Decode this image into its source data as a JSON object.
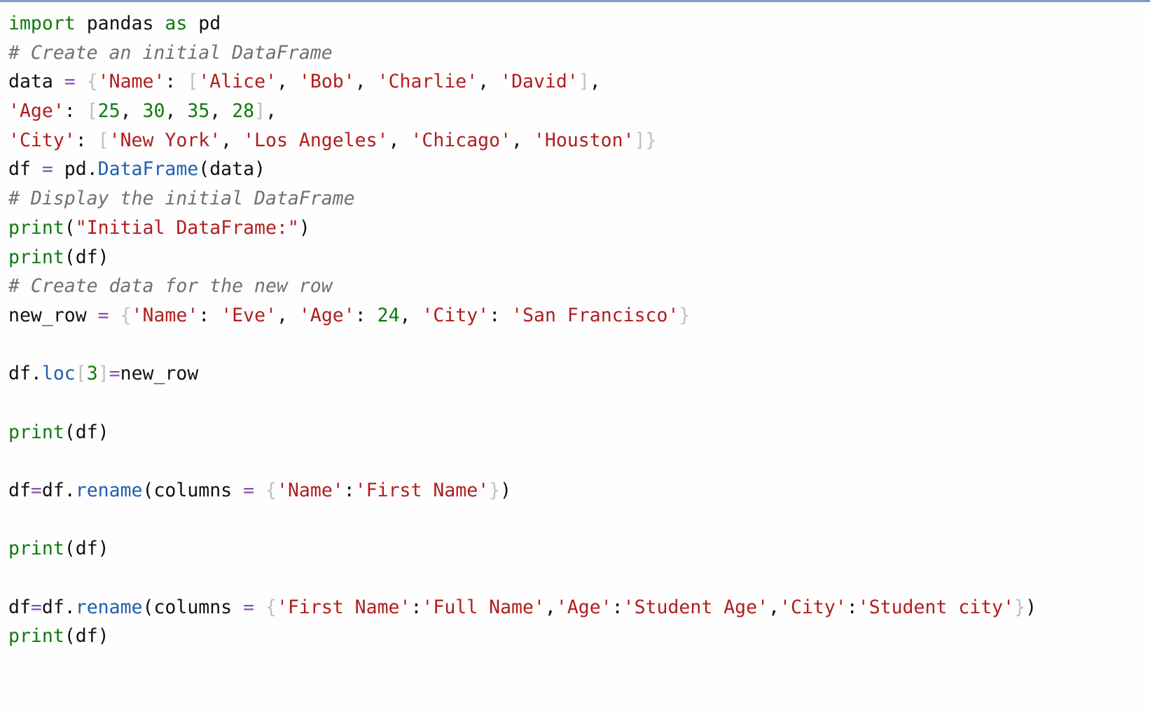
{
  "editor": {
    "language": "python",
    "lines": [
      {
        "tokens": [
          {
            "t": "import",
            "c": "kw"
          },
          {
            "t": " pandas ",
            "c": "txt"
          },
          {
            "t": "as",
            "c": "kw"
          },
          {
            "t": " pd",
            "c": "txt"
          }
        ]
      },
      {
        "tokens": [
          {
            "t": "# Create an initial DataFrame",
            "c": "cmt"
          }
        ]
      },
      {
        "tokens": [
          {
            "t": "data ",
            "c": "txt"
          },
          {
            "t": "=",
            "c": "op"
          },
          {
            "t": " ",
            "c": "txt"
          },
          {
            "t": "{",
            "c": "br"
          },
          {
            "t": "'Name'",
            "c": "str"
          },
          {
            "t": ": ",
            "c": "txt"
          },
          {
            "t": "[",
            "c": "br"
          },
          {
            "t": "'Alice'",
            "c": "str"
          },
          {
            "t": ", ",
            "c": "txt"
          },
          {
            "t": "'Bob'",
            "c": "str"
          },
          {
            "t": ", ",
            "c": "txt"
          },
          {
            "t": "'Charlie'",
            "c": "str"
          },
          {
            "t": ", ",
            "c": "txt"
          },
          {
            "t": "'David'",
            "c": "str"
          },
          {
            "t": "]",
            "c": "br"
          },
          {
            "t": ",",
            "c": "txt"
          }
        ]
      },
      {
        "tokens": [
          {
            "t": "'Age'",
            "c": "str"
          },
          {
            "t": ": ",
            "c": "txt"
          },
          {
            "t": "[",
            "c": "br"
          },
          {
            "t": "25",
            "c": "num"
          },
          {
            "t": ", ",
            "c": "txt"
          },
          {
            "t": "30",
            "c": "num"
          },
          {
            "t": ", ",
            "c": "txt"
          },
          {
            "t": "35",
            "c": "num"
          },
          {
            "t": ", ",
            "c": "txt"
          },
          {
            "t": "28",
            "c": "num"
          },
          {
            "t": "]",
            "c": "br"
          },
          {
            "t": ",",
            "c": "txt"
          }
        ]
      },
      {
        "tokens": [
          {
            "t": "'City'",
            "c": "str"
          },
          {
            "t": ": ",
            "c": "txt"
          },
          {
            "t": "[",
            "c": "br"
          },
          {
            "t": "'New York'",
            "c": "str"
          },
          {
            "t": ", ",
            "c": "txt"
          },
          {
            "t": "'Los Angeles'",
            "c": "str"
          },
          {
            "t": ", ",
            "c": "txt"
          },
          {
            "t": "'Chicago'",
            "c": "str"
          },
          {
            "t": ", ",
            "c": "txt"
          },
          {
            "t": "'Houston'",
            "c": "str"
          },
          {
            "t": "]}",
            "c": "br"
          }
        ]
      },
      {
        "tokens": [
          {
            "t": "df ",
            "c": "txt"
          },
          {
            "t": "=",
            "c": "op"
          },
          {
            "t": " pd.",
            "c": "txt"
          },
          {
            "t": "DataFrame",
            "c": "fn"
          },
          {
            "t": "(data)",
            "c": "txt"
          }
        ]
      },
      {
        "tokens": [
          {
            "t": "# Display the initial DataFrame",
            "c": "cmt"
          }
        ]
      },
      {
        "tokens": [
          {
            "t": "print",
            "c": "kw"
          },
          {
            "t": "(",
            "c": "txt"
          },
          {
            "t": "\"Initial DataFrame:\"",
            "c": "str"
          },
          {
            "t": ")",
            "c": "txt"
          }
        ]
      },
      {
        "tokens": [
          {
            "t": "print",
            "c": "kw"
          },
          {
            "t": "(df)",
            "c": "txt"
          }
        ]
      },
      {
        "tokens": [
          {
            "t": "# Create data for the new row",
            "c": "cmt"
          }
        ]
      },
      {
        "tokens": [
          {
            "t": "new_row ",
            "c": "txt"
          },
          {
            "t": "=",
            "c": "op"
          },
          {
            "t": " ",
            "c": "txt"
          },
          {
            "t": "{",
            "c": "br"
          },
          {
            "t": "'Name'",
            "c": "str"
          },
          {
            "t": ": ",
            "c": "txt"
          },
          {
            "t": "'Eve'",
            "c": "str"
          },
          {
            "t": ", ",
            "c": "txt"
          },
          {
            "t": "'Age'",
            "c": "str"
          },
          {
            "t": ": ",
            "c": "txt"
          },
          {
            "t": "24",
            "c": "num"
          },
          {
            "t": ", ",
            "c": "txt"
          },
          {
            "t": "'City'",
            "c": "str"
          },
          {
            "t": ": ",
            "c": "txt"
          },
          {
            "t": "'San Francisco'",
            "c": "str"
          },
          {
            "t": "}",
            "c": "br"
          }
        ]
      },
      {
        "tokens": []
      },
      {
        "tokens": [
          {
            "t": "df.",
            "c": "txt"
          },
          {
            "t": "loc",
            "c": "fn"
          },
          {
            "t": "[",
            "c": "br"
          },
          {
            "t": "3",
            "c": "num"
          },
          {
            "t": "]",
            "c": "br"
          },
          {
            "t": "=",
            "c": "op"
          },
          {
            "t": "new_row",
            "c": "txt"
          }
        ]
      },
      {
        "tokens": []
      },
      {
        "tokens": [
          {
            "t": "print",
            "c": "kw"
          },
          {
            "t": "(df)",
            "c": "txt"
          }
        ]
      },
      {
        "tokens": []
      },
      {
        "tokens": [
          {
            "t": "df",
            "c": "txt"
          },
          {
            "t": "=",
            "c": "op"
          },
          {
            "t": "df.",
            "c": "txt"
          },
          {
            "t": "rename",
            "c": "fn"
          },
          {
            "t": "(columns ",
            "c": "txt"
          },
          {
            "t": "=",
            "c": "op"
          },
          {
            "t": " ",
            "c": "txt"
          },
          {
            "t": "{",
            "c": "br"
          },
          {
            "t": "'Name'",
            "c": "str"
          },
          {
            "t": ":",
            "c": "txt"
          },
          {
            "t": "'First Name'",
            "c": "str"
          },
          {
            "t": "}",
            "c": "br"
          },
          {
            "t": ")",
            "c": "txt"
          }
        ]
      },
      {
        "tokens": []
      },
      {
        "tokens": [
          {
            "t": "print",
            "c": "kw"
          },
          {
            "t": "(df)",
            "c": "txt"
          }
        ]
      },
      {
        "tokens": []
      },
      {
        "tokens": [
          {
            "t": "df",
            "c": "txt"
          },
          {
            "t": "=",
            "c": "op"
          },
          {
            "t": "df.",
            "c": "txt"
          },
          {
            "t": "rename",
            "c": "fn"
          },
          {
            "t": "(columns ",
            "c": "txt"
          },
          {
            "t": "=",
            "c": "op"
          },
          {
            "t": " ",
            "c": "txt"
          },
          {
            "t": "{",
            "c": "br"
          },
          {
            "t": "'First Name'",
            "c": "str"
          },
          {
            "t": ":",
            "c": "txt"
          },
          {
            "t": "'Full Name'",
            "c": "str"
          },
          {
            "t": ",",
            "c": "txt"
          },
          {
            "t": "'Age'",
            "c": "str"
          },
          {
            "t": ":",
            "c": "txt"
          },
          {
            "t": "'Student Age'",
            "c": "str"
          },
          {
            "t": ",",
            "c": "txt"
          },
          {
            "t": "'City'",
            "c": "str"
          },
          {
            "t": ":",
            "c": "txt"
          },
          {
            "t": "'Student city'",
            "c": "str"
          },
          {
            "t": "}",
            "c": "br"
          },
          {
            "t": ")",
            "c": "txt"
          }
        ]
      },
      {
        "tokens": [
          {
            "t": "print",
            "c": "kw"
          },
          {
            "t": "(df)",
            "c": "txt"
          }
        ]
      }
    ]
  }
}
